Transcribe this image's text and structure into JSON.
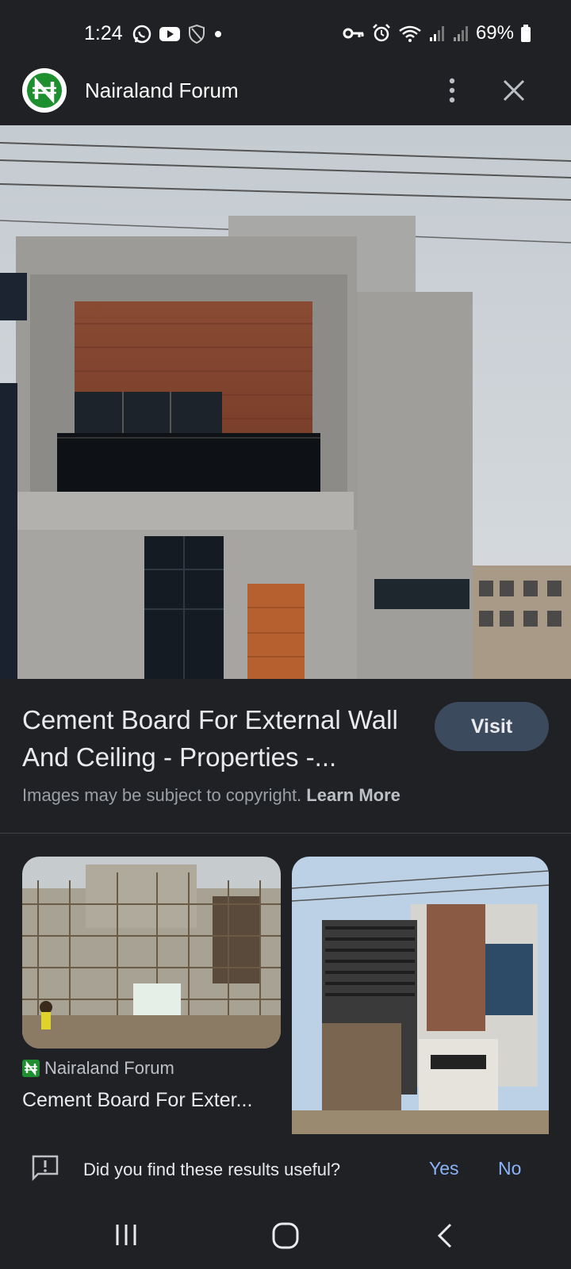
{
  "status_bar": {
    "time": "1:24",
    "battery": "69%",
    "left_icons": [
      "whatsapp-icon",
      "youtube-icon",
      "shield-icon",
      "dot-icon"
    ],
    "right_icons": [
      "key-icon",
      "alarm-icon",
      "wifi-icon",
      "signal-icon",
      "signal-icon",
      "battery-icon"
    ]
  },
  "app_bar": {
    "site_name": "Nairaland Forum",
    "logo_icon": "nairaland-logo-icon",
    "menu_icon": "more-vert-icon",
    "close_icon": "close-icon"
  },
  "result": {
    "title": "Cement Board For External Wall And Ceiling - Properties -...",
    "visit_label": "Visit",
    "copyright_text": "Images may be subject to copyright.",
    "learn_more": "Learn More"
  },
  "related": [
    {
      "source": "Nairaland Forum",
      "title": "Cement Board For Exter..."
    },
    {
      "source": "",
      "title": ""
    }
  ],
  "feedback": {
    "question": "Did you find these results useful?",
    "yes": "Yes",
    "no": "No"
  },
  "nav": {
    "icons": [
      "recents-icon",
      "home-icon",
      "back-icon"
    ]
  },
  "colors": {
    "background": "#202124",
    "visit_button": "#3c4a5e",
    "link_blue": "#8ab4f8",
    "nairaland_green": "#1e8f2e"
  }
}
